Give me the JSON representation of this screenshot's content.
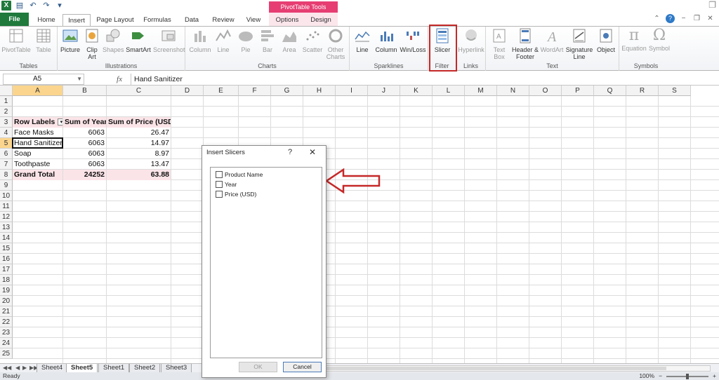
{
  "quick_access": {
    "icons": [
      "excel-logo",
      "save-icon",
      "undo-icon",
      "redo-icon",
      "customize-icon"
    ]
  },
  "context_tab": {
    "title": "PivotTable Tools",
    "color": "#e63e73"
  },
  "tabs": [
    "File",
    "Home",
    "Insert",
    "Page Layout",
    "Formulas",
    "Data",
    "Review",
    "View",
    "Options",
    "Design"
  ],
  "active_tab": "Insert",
  "ribbon": {
    "groups": [
      {
        "label": "Tables",
        "buttons": [
          "PivotTable",
          "Table"
        ]
      },
      {
        "label": "Illustrations",
        "buttons": [
          "Picture",
          "Clip Art",
          "Shapes",
          "SmartArt",
          "Screenshot"
        ]
      },
      {
        "label": "Charts",
        "buttons": [
          "Column",
          "Line",
          "Pie",
          "Bar",
          "Area",
          "Scatter",
          "Other Charts"
        ]
      },
      {
        "label": "Sparklines",
        "buttons": [
          "Line",
          "Column",
          "Win/Loss"
        ]
      },
      {
        "label": "Filter",
        "buttons": [
          "Slicer"
        ]
      },
      {
        "label": "Links",
        "buttons": [
          "Hyperlink"
        ]
      },
      {
        "label": "Text",
        "buttons": [
          "Text Box",
          "Header & Footer",
          "WordArt",
          "Signature Line",
          "Object"
        ]
      },
      {
        "label": "Symbols",
        "buttons": [
          "Equation",
          "Symbol"
        ]
      }
    ],
    "highlight_color": "#c62828"
  },
  "formula_bar": {
    "name_box": "A5",
    "fx": "fx",
    "content": "Hand Sanitizer"
  },
  "columns": [
    "A",
    "B",
    "C",
    "D",
    "E",
    "F",
    "G",
    "H",
    "I",
    "J",
    "K",
    "L",
    "M",
    "N",
    "O",
    "P",
    "Q",
    "R",
    "S"
  ],
  "rows": [
    "1",
    "2",
    "3",
    "4",
    "5",
    "6",
    "7",
    "8",
    "9",
    "10",
    "11",
    "12",
    "13",
    "14",
    "15",
    "16",
    "17",
    "18",
    "19",
    "20",
    "21",
    "22",
    "23",
    "24",
    "25"
  ],
  "pivot": {
    "headers": [
      "Row Labels",
      "Sum of Year",
      "Sum of Price (USD)"
    ],
    "data": [
      [
        "Face Masks",
        "6063",
        "26.47"
      ],
      [
        "Hand Sanitizer",
        "6063",
        "14.97"
      ],
      [
        "Soap",
        "6063",
        "8.97"
      ],
      [
        "Toothpaste",
        "6063",
        "13.47"
      ]
    ],
    "total": [
      "Grand Total",
      "24252",
      "63.88"
    ],
    "fill_color": "#fbe4e8"
  },
  "sheets": [
    "Sheet4",
    "Sheet5",
    "Sheet1",
    "Sheet2",
    "Sheet3"
  ],
  "active_sheet": "Sheet5",
  "status": {
    "text": "Ready",
    "zoom": "100%"
  },
  "dialog": {
    "title": "Insert Slicers",
    "help": "?",
    "close": "✕",
    "fields": [
      "Product Name",
      "Year",
      "Price (USD)"
    ],
    "ok": "OK",
    "cancel": "Cancel"
  },
  "annotation_arrow_color": "#c62828"
}
